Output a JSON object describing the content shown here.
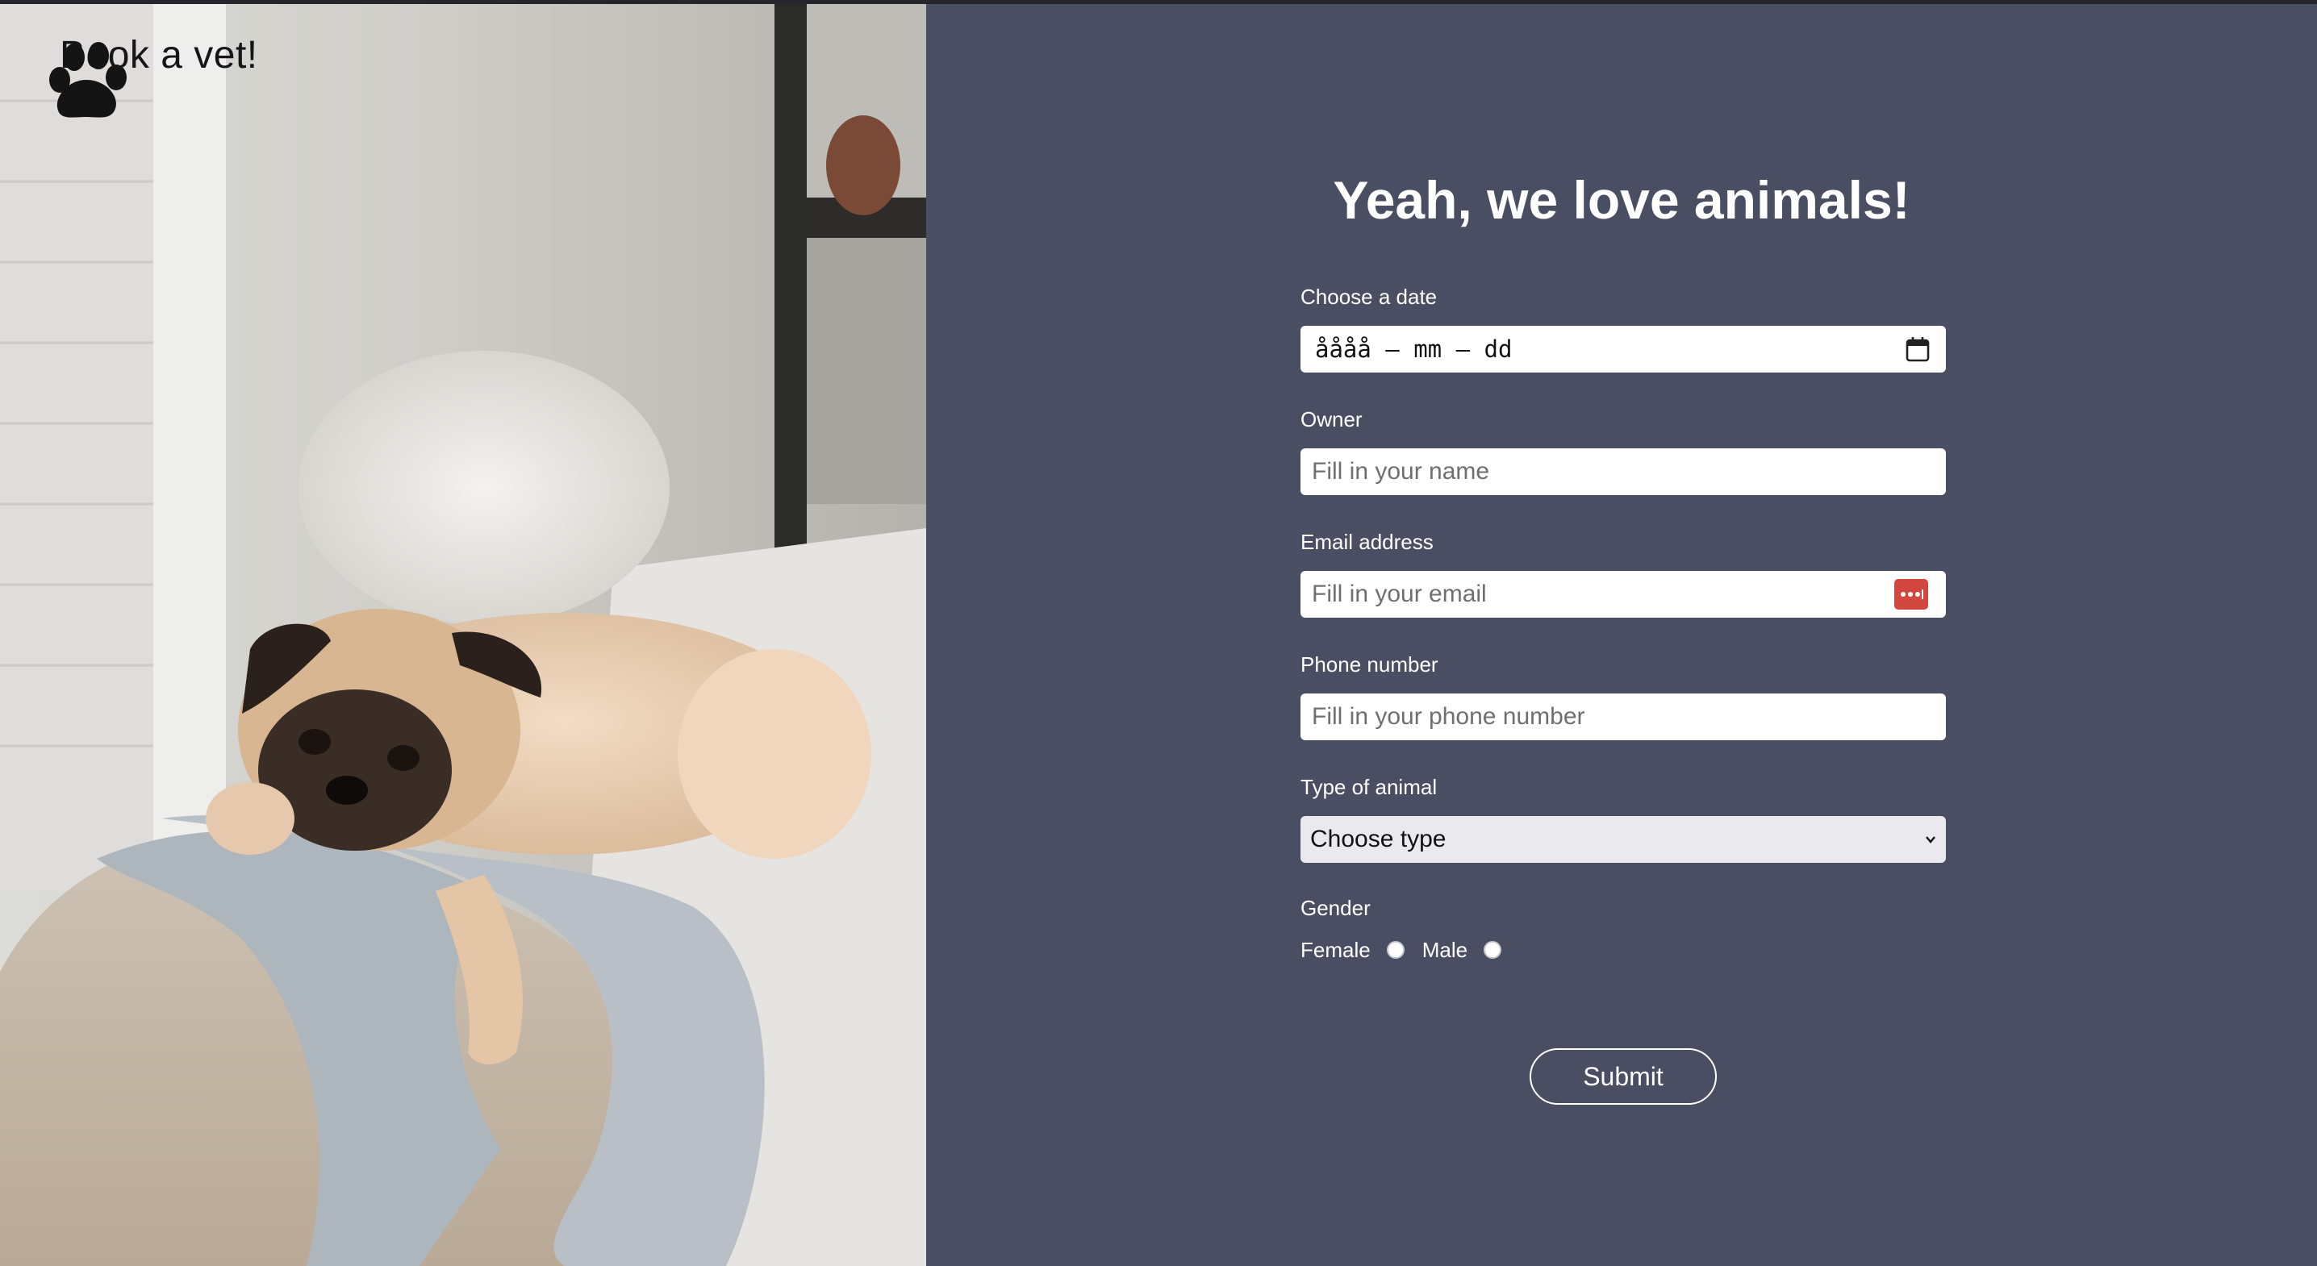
{
  "brand": {
    "logo_icon": "paw-icon",
    "name": "Book a vet!"
  },
  "hero_image": {
    "subject": "pug-photo"
  },
  "form": {
    "headline": "Yeah, we love animals!",
    "date": {
      "label": "Choose a date",
      "value": "åååå – mm – dd",
      "icon": "calendar-icon"
    },
    "owner": {
      "label": "Owner",
      "placeholder": "Fill in your name"
    },
    "email": {
      "label": "Email address",
      "placeholder": "Fill in your email",
      "icon": "password-manager-icon"
    },
    "phone": {
      "label": "Phone number",
      "placeholder": "Fill in your phone number"
    },
    "animal_type": {
      "label": "Type of animal",
      "selected": "Choose type",
      "icon": "chevron-down-icon"
    },
    "gender": {
      "label": "Gender",
      "options": [
        "Female",
        "Male"
      ]
    },
    "submit_label": "Submit"
  },
  "colors": {
    "panel_background": "#4a4e62",
    "accent_icon": "#d2473f",
    "text": "#ffffff"
  }
}
